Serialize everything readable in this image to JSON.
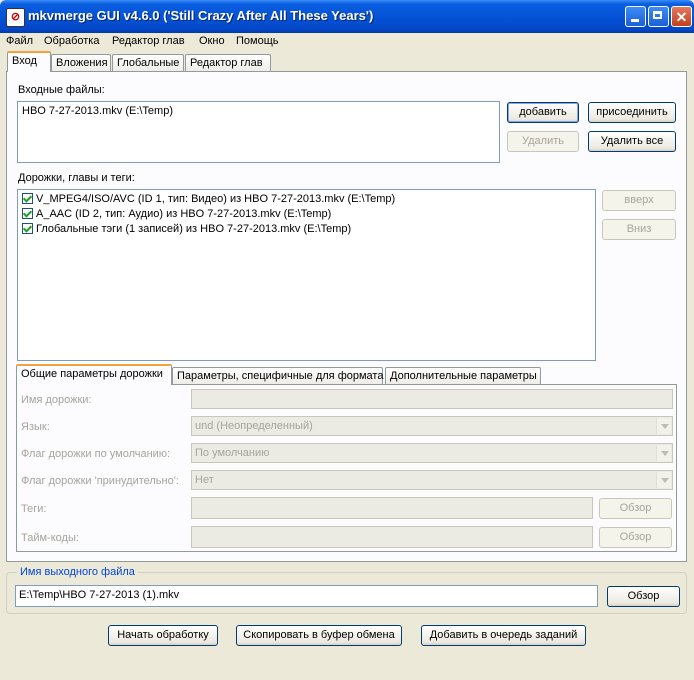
{
  "window": {
    "title": "mkvmerge GUI v4.6.0 ('Still Crazy After All These Years')",
    "icons": [
      "app-icon",
      "minimize-icon",
      "maximize-icon",
      "close-icon"
    ]
  },
  "menu": {
    "items": [
      {
        "label": "Файл"
      },
      {
        "label": "Обработка"
      },
      {
        "label": "Редактор глав"
      },
      {
        "label": "Окно"
      },
      {
        "label": "Помощь"
      }
    ]
  },
  "tabs": [
    {
      "label": "Вход",
      "active": true
    },
    {
      "label": "Вложения",
      "active": false
    },
    {
      "label": "Глобальные",
      "active": false
    },
    {
      "label": "Редактор глав",
      "active": false
    }
  ],
  "input": {
    "files_label": "Входные файлы:",
    "files": [
      "HBO 7-27-2013.mkv (E:\\Temp)"
    ],
    "add_button": "добавить",
    "append_button": "присоединить",
    "remove_button": "Удалить",
    "remove_all_button": "Удалить все"
  },
  "tracks": {
    "label": "Дорожки, главы и теги:",
    "items": [
      {
        "label": "V_MPEG4/ISO/AVC (ID 1, тип: Видео) из HBO 7-27-2013.mkv (E:\\Temp)",
        "checked": true
      },
      {
        "label": "A_AAC (ID 2, тип: Аудио) из HBO 7-27-2013.mkv (E:\\Temp)",
        "checked": true
      },
      {
        "label": "Глобальные тэги (1 записей) из HBO 7-27-2013.mkv (E:\\Temp)",
        "checked": true
      }
    ],
    "up_button": "вверх",
    "down_button": "Вниз"
  },
  "subtabs": [
    {
      "label": "Общие параметры дорожки",
      "active": true
    },
    {
      "label": "Параметры, специфичные для формата",
      "active": false
    },
    {
      "label": "Дополнительные параметры",
      "active": false
    }
  ],
  "track_params": {
    "name_label": "Имя дорожки:",
    "name_value": "",
    "language_label": "Язык:",
    "language_value": "und (Неопределенный)",
    "default_flag_label": "Флаг дорожки по умолчанию:",
    "default_flag_value": "По умолчанию",
    "forced_flag_label": "Флаг дорожки 'принудительно':",
    "forced_flag_value": "Нет",
    "tags_label": "Теги:",
    "tags_value": "",
    "tags_browse": "Обзор",
    "timecodes_label": "Тайм-коды:",
    "timecodes_value": "",
    "timecodes_browse": "Обзор"
  },
  "output": {
    "group_title": "Имя выходного файла",
    "filename": "E:\\Temp\\HBO 7-27-2013 (1).mkv",
    "browse_button": "Обзор"
  },
  "actions": {
    "start": "Начать обработку",
    "copy": "Скопировать в буфер обмена",
    "queue": "Добавить в очередь заданий"
  }
}
